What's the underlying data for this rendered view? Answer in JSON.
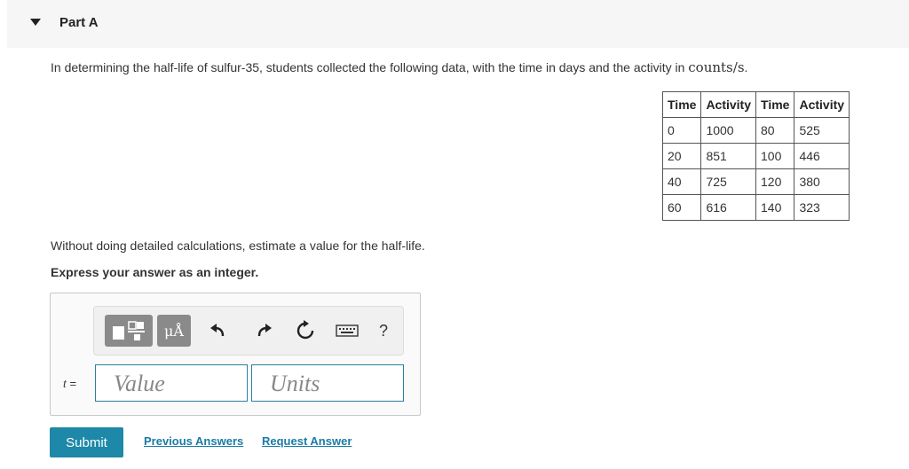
{
  "part": {
    "title": "Part A"
  },
  "question": {
    "text_before": "In determining the half-life of sulfur-35, students collected the following data, with the time in days and the activity in ",
    "units_text": "counts/s",
    "text_after": ".",
    "estimate_text": "Without doing detailed calculations, estimate a value for the half-life.",
    "express_text": "Express your answer as an integer."
  },
  "table": {
    "headers": [
      "Time",
      "Activity",
      "Time",
      "Activity"
    ],
    "rows": [
      [
        "0",
        "1000",
        "80",
        "525"
      ],
      [
        "20",
        "851",
        "100",
        "446"
      ],
      [
        "40",
        "725",
        "120",
        "380"
      ],
      [
        "60",
        "616",
        "140",
        "323"
      ]
    ]
  },
  "toolbar": {
    "mu_label": "μÅ",
    "help_label": "?"
  },
  "answer": {
    "var_label": "t",
    "equals": " =",
    "value_placeholder": "Value",
    "units_placeholder": "Units"
  },
  "actions": {
    "submit_label": "Submit",
    "previous_answers_label": "Previous Answers",
    "request_answer_label": "Request Answer"
  }
}
